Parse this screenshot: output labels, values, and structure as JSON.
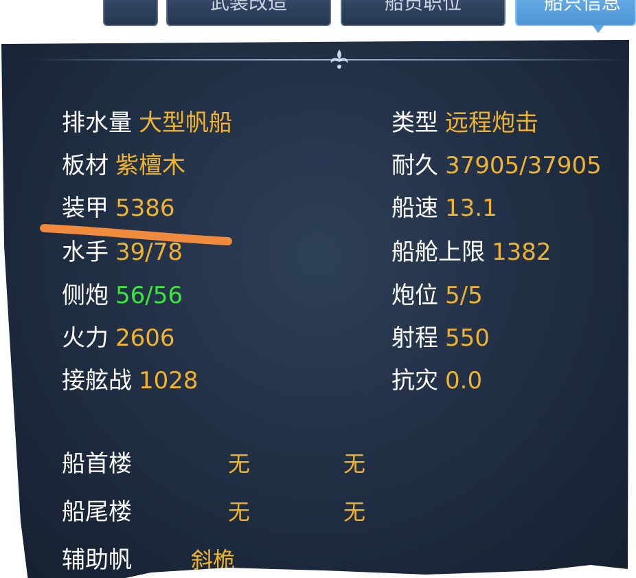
{
  "tabs": [
    {
      "label": "",
      "active": false
    },
    {
      "label": "武装改造",
      "active": false
    },
    {
      "label": "船员职位",
      "active": false
    },
    {
      "label": "船只信息",
      "active": true
    }
  ],
  "left_stats": [
    {
      "label": "排水量",
      "value": "大型帆船"
    },
    {
      "label": "板材",
      "value": "紫檀木"
    },
    {
      "label": "装甲",
      "value": "5386"
    },
    {
      "label": "水手",
      "value": "39/78"
    },
    {
      "label": "侧炮",
      "value": "56/56",
      "highlight": "#39e83a"
    },
    {
      "label": "火力",
      "value": "2606"
    },
    {
      "label": "接舷战",
      "value": "1028"
    }
  ],
  "right_stats": [
    {
      "label": "类型",
      "value": "远程炮击"
    },
    {
      "label": "耐久",
      "value": "37905/37905"
    },
    {
      "label": "船速",
      "value": "13.1"
    },
    {
      "label": "船舱上限",
      "value": "1382"
    },
    {
      "label": "炮位",
      "value": "5/5"
    },
    {
      "label": "射程",
      "value": "550"
    },
    {
      "label": "抗灾",
      "value": "0.0"
    }
  ],
  "equipment": [
    {
      "label": "船首楼",
      "slot1": "无",
      "slot2": "无"
    },
    {
      "label": "船尾楼",
      "slot1": "无",
      "slot2": "无"
    },
    {
      "label": "辅助帆",
      "slot1": "斜桅",
      "slot2": ""
    }
  ],
  "colors": {
    "label": "#ffffff",
    "value": "#f0b32e",
    "highlight_green": "#39e83a",
    "annotation_stroke": "#f08a3c",
    "panel": "#1f2d42"
  },
  "ornament_icon": "fleur-ornament-icon"
}
